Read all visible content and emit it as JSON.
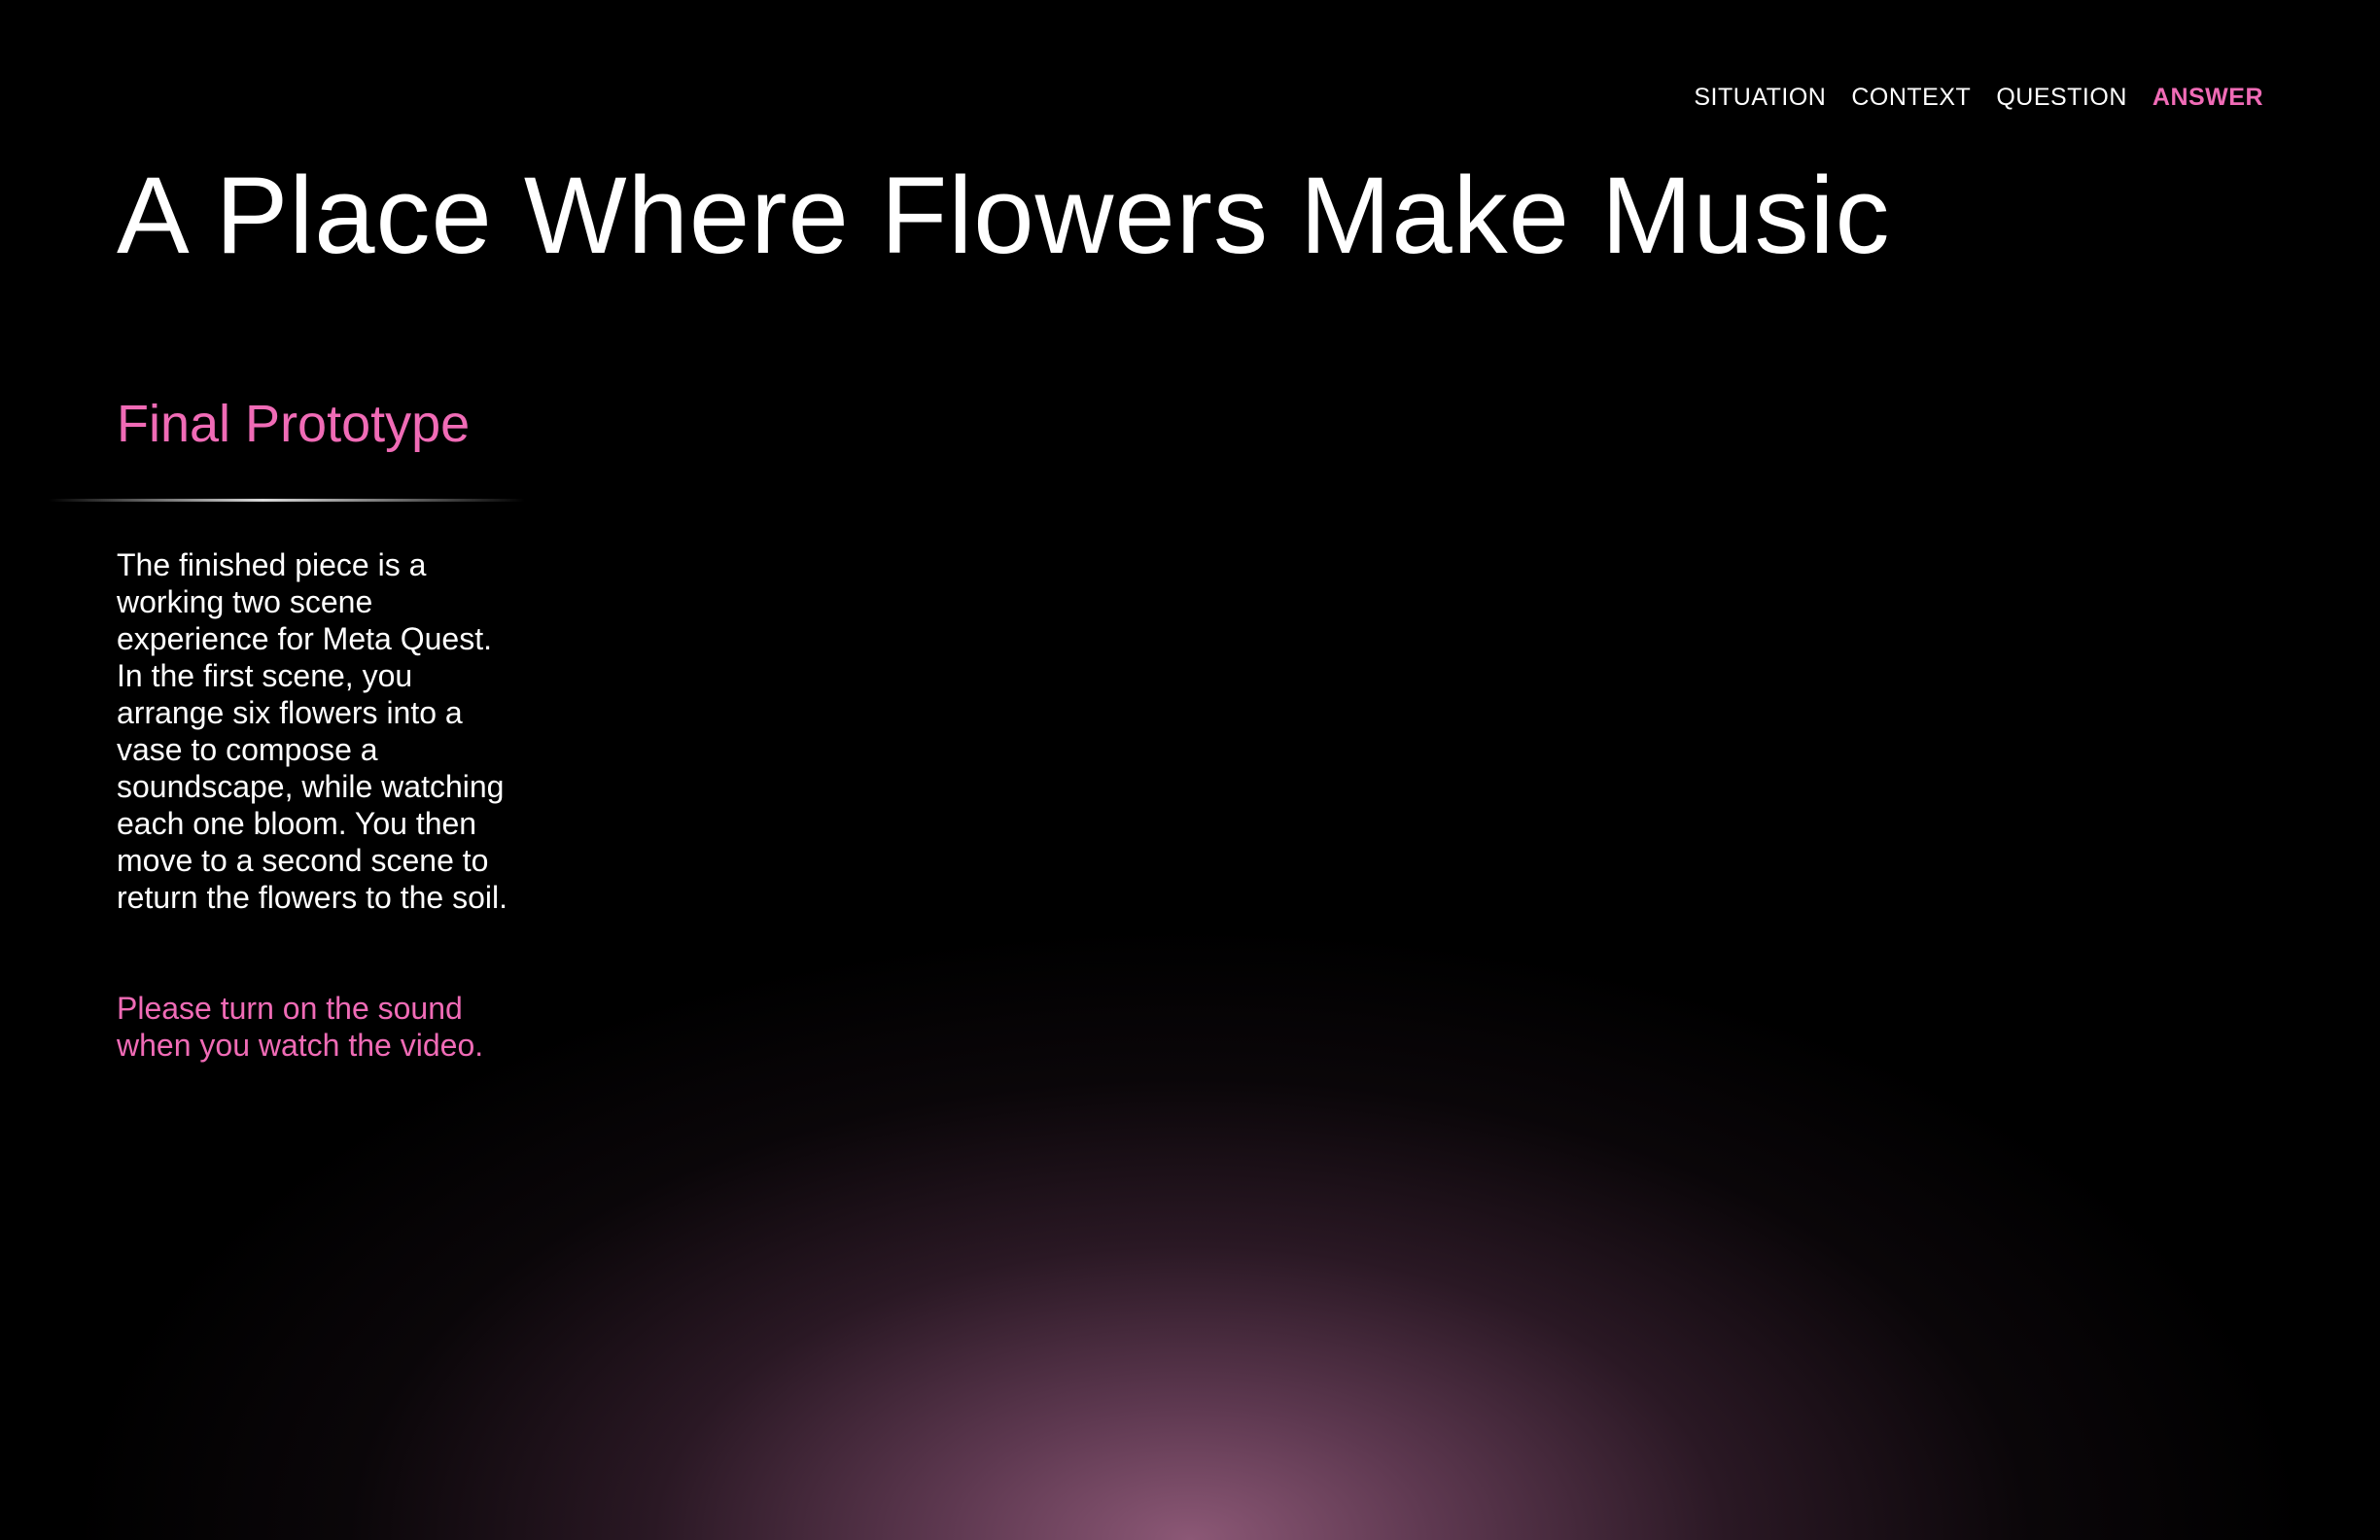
{
  "nav": {
    "items": [
      {
        "label": "SITUATION"
      },
      {
        "label": "CONTEXT"
      },
      {
        "label": "QUESTION"
      },
      {
        "label": "ANSWER"
      }
    ],
    "active": "ANSWER"
  },
  "page": {
    "title": "A Place Where Flowers Make Music"
  },
  "section": {
    "heading": "Final Prototype",
    "body": "The finished piece is a working two scene experience for Meta Quest. In the first scene, you arrange six flowers into a vase to compose a soundscape, while watching each one bloom. You then move to a second scene to return the flowers to the soil.",
    "note": "Please turn on the sound when you watch the video."
  },
  "colors": {
    "background": "#000000",
    "text": "#ffffff",
    "accent": "#f06bb6",
    "glow": "#8c5876"
  }
}
